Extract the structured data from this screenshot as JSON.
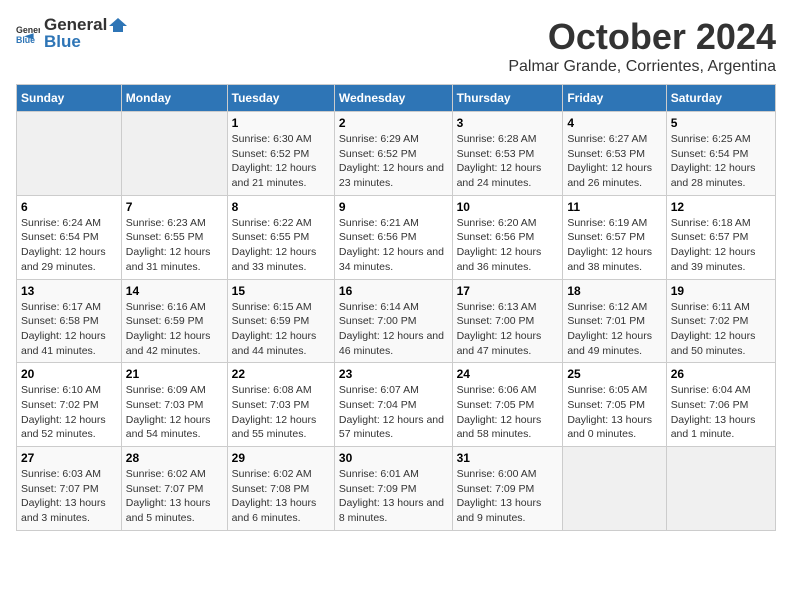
{
  "logo": {
    "general": "General",
    "blue": "Blue"
  },
  "title": "October 2024",
  "subtitle": "Palmar Grande, Corrientes, Argentina",
  "days_of_week": [
    "Sunday",
    "Monday",
    "Tuesday",
    "Wednesday",
    "Thursday",
    "Friday",
    "Saturday"
  ],
  "weeks": [
    [
      {
        "day": "",
        "detail": ""
      },
      {
        "day": "",
        "detail": ""
      },
      {
        "day": "1",
        "detail": "Sunrise: 6:30 AM\nSunset: 6:52 PM\nDaylight: 12 hours and 21 minutes."
      },
      {
        "day": "2",
        "detail": "Sunrise: 6:29 AM\nSunset: 6:52 PM\nDaylight: 12 hours and 23 minutes."
      },
      {
        "day": "3",
        "detail": "Sunrise: 6:28 AM\nSunset: 6:53 PM\nDaylight: 12 hours and 24 minutes."
      },
      {
        "day": "4",
        "detail": "Sunrise: 6:27 AM\nSunset: 6:53 PM\nDaylight: 12 hours and 26 minutes."
      },
      {
        "day": "5",
        "detail": "Sunrise: 6:25 AM\nSunset: 6:54 PM\nDaylight: 12 hours and 28 minutes."
      }
    ],
    [
      {
        "day": "6",
        "detail": "Sunrise: 6:24 AM\nSunset: 6:54 PM\nDaylight: 12 hours and 29 minutes."
      },
      {
        "day": "7",
        "detail": "Sunrise: 6:23 AM\nSunset: 6:55 PM\nDaylight: 12 hours and 31 minutes."
      },
      {
        "day": "8",
        "detail": "Sunrise: 6:22 AM\nSunset: 6:55 PM\nDaylight: 12 hours and 33 minutes."
      },
      {
        "day": "9",
        "detail": "Sunrise: 6:21 AM\nSunset: 6:56 PM\nDaylight: 12 hours and 34 minutes."
      },
      {
        "day": "10",
        "detail": "Sunrise: 6:20 AM\nSunset: 6:56 PM\nDaylight: 12 hours and 36 minutes."
      },
      {
        "day": "11",
        "detail": "Sunrise: 6:19 AM\nSunset: 6:57 PM\nDaylight: 12 hours and 38 minutes."
      },
      {
        "day": "12",
        "detail": "Sunrise: 6:18 AM\nSunset: 6:57 PM\nDaylight: 12 hours and 39 minutes."
      }
    ],
    [
      {
        "day": "13",
        "detail": "Sunrise: 6:17 AM\nSunset: 6:58 PM\nDaylight: 12 hours and 41 minutes."
      },
      {
        "day": "14",
        "detail": "Sunrise: 6:16 AM\nSunset: 6:59 PM\nDaylight: 12 hours and 42 minutes."
      },
      {
        "day": "15",
        "detail": "Sunrise: 6:15 AM\nSunset: 6:59 PM\nDaylight: 12 hours and 44 minutes."
      },
      {
        "day": "16",
        "detail": "Sunrise: 6:14 AM\nSunset: 7:00 PM\nDaylight: 12 hours and 46 minutes."
      },
      {
        "day": "17",
        "detail": "Sunrise: 6:13 AM\nSunset: 7:00 PM\nDaylight: 12 hours and 47 minutes."
      },
      {
        "day": "18",
        "detail": "Sunrise: 6:12 AM\nSunset: 7:01 PM\nDaylight: 12 hours and 49 minutes."
      },
      {
        "day": "19",
        "detail": "Sunrise: 6:11 AM\nSunset: 7:02 PM\nDaylight: 12 hours and 50 minutes."
      }
    ],
    [
      {
        "day": "20",
        "detail": "Sunrise: 6:10 AM\nSunset: 7:02 PM\nDaylight: 12 hours and 52 minutes."
      },
      {
        "day": "21",
        "detail": "Sunrise: 6:09 AM\nSunset: 7:03 PM\nDaylight: 12 hours and 54 minutes."
      },
      {
        "day": "22",
        "detail": "Sunrise: 6:08 AM\nSunset: 7:03 PM\nDaylight: 12 hours and 55 minutes."
      },
      {
        "day": "23",
        "detail": "Sunrise: 6:07 AM\nSunset: 7:04 PM\nDaylight: 12 hours and 57 minutes."
      },
      {
        "day": "24",
        "detail": "Sunrise: 6:06 AM\nSunset: 7:05 PM\nDaylight: 12 hours and 58 minutes."
      },
      {
        "day": "25",
        "detail": "Sunrise: 6:05 AM\nSunset: 7:05 PM\nDaylight: 13 hours and 0 minutes."
      },
      {
        "day": "26",
        "detail": "Sunrise: 6:04 AM\nSunset: 7:06 PM\nDaylight: 13 hours and 1 minute."
      }
    ],
    [
      {
        "day": "27",
        "detail": "Sunrise: 6:03 AM\nSunset: 7:07 PM\nDaylight: 13 hours and 3 minutes."
      },
      {
        "day": "28",
        "detail": "Sunrise: 6:02 AM\nSunset: 7:07 PM\nDaylight: 13 hours and 5 minutes."
      },
      {
        "day": "29",
        "detail": "Sunrise: 6:02 AM\nSunset: 7:08 PM\nDaylight: 13 hours and 6 minutes."
      },
      {
        "day": "30",
        "detail": "Sunrise: 6:01 AM\nSunset: 7:09 PM\nDaylight: 13 hours and 8 minutes."
      },
      {
        "day": "31",
        "detail": "Sunrise: 6:00 AM\nSunset: 7:09 PM\nDaylight: 13 hours and 9 minutes."
      },
      {
        "day": "",
        "detail": ""
      },
      {
        "day": "",
        "detail": ""
      }
    ]
  ]
}
